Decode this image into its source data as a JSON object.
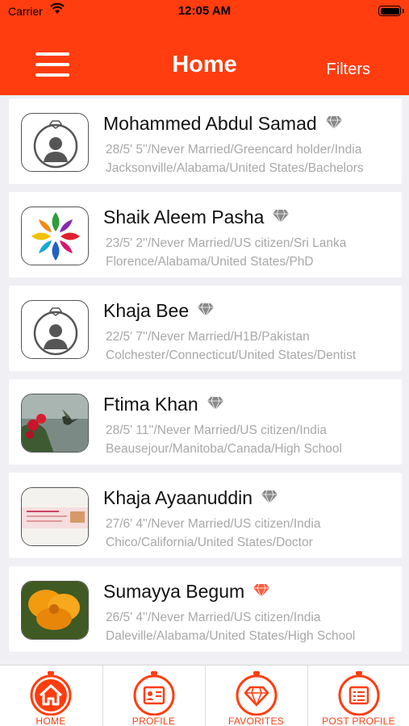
{
  "status_bar": {
    "carrier": "Carrier",
    "time": "12:05 AM"
  },
  "nav": {
    "title": "Home",
    "filters_label": "Filters"
  },
  "colors": {
    "brand": "#ff3d0f",
    "diamond_gray": "#8a8a8a",
    "diamond_red": "#ff5a3c"
  },
  "profiles": [
    {
      "name": "Mohammed Abdul Samad",
      "line1": "28/5' 5''/Never Married/Greencard holder/India",
      "line2": "Jacksonville/Alabama/United States/Bachelors",
      "photo": "avatar-placeholder",
      "diamond": "gray"
    },
    {
      "name": "Shaik Aleem Pasha",
      "line1": "23/5' 2''/Never Married/US citizen/Sri Lanka",
      "line2": "Florence/Alabama/United States/PhD",
      "photo": "colorful-logo",
      "diamond": "gray"
    },
    {
      "name": "Khaja Bee",
      "line1": "22/5' 7''/Never Married/H1B/Pakistan",
      "line2": "Colchester/Connecticut/United States/Dentist",
      "photo": "avatar-placeholder",
      "diamond": "gray"
    },
    {
      "name": "Ftima Khan",
      "line1": "28/5' 11''/Never Married/US citizen/India",
      "line2": "Beausejour/Manitoba/Canada/High School",
      "photo": "hummingbird-photo",
      "diamond": "gray"
    },
    {
      "name": "Khaja  Ayaanuddin",
      "line1": "27/6' 4''/Never Married/US citizen/India",
      "line2": "Chico/California/United States/Doctor",
      "photo": "document-photo",
      "diamond": "gray"
    },
    {
      "name": "Sumayya Begum",
      "line1": "26/5' 4''/Never Married/US citizen/India",
      "line2": "Daleville/Alabama/United States/High School",
      "photo": "orange-flower-photo",
      "diamond": "red"
    }
  ],
  "tabs": [
    {
      "label": "HOME",
      "icon": "home-icon"
    },
    {
      "label": "PROFILE",
      "icon": "profile-card-icon"
    },
    {
      "label": "FAVORITES",
      "icon": "diamond-icon"
    },
    {
      "label": "POST PROFILE",
      "icon": "list-icon"
    }
  ]
}
